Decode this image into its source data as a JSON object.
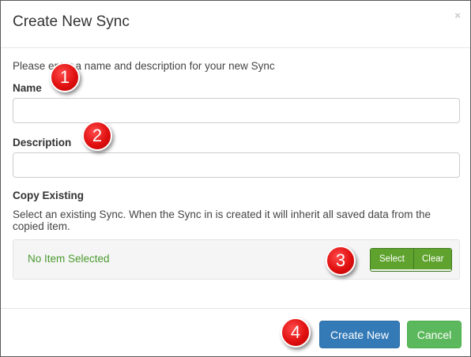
{
  "dialog": {
    "title": "Create New Sync",
    "close_label": "×"
  },
  "form": {
    "intro": "Please enter a name and description for your new Sync",
    "name_label": "Name",
    "name_value": "",
    "description_label": "Description",
    "description_value": "",
    "copy_label": "Copy Existing",
    "copy_help": "Select an existing Sync. When the Sync in is created it will inherit all saved data from the copied item.",
    "selected_item_text": "No Item Selected",
    "select_button": "Select",
    "clear_button": "Clear"
  },
  "footer": {
    "create_button": "Create New",
    "cancel_button": "Cancel"
  },
  "annotations": {
    "markers": [
      "1",
      "2",
      "3",
      "4"
    ],
    "marker_color": "#e01010"
  },
  "colors": {
    "primary": "#337ab7",
    "success": "#5cb85c",
    "selected_text": "#4a9b2f"
  }
}
